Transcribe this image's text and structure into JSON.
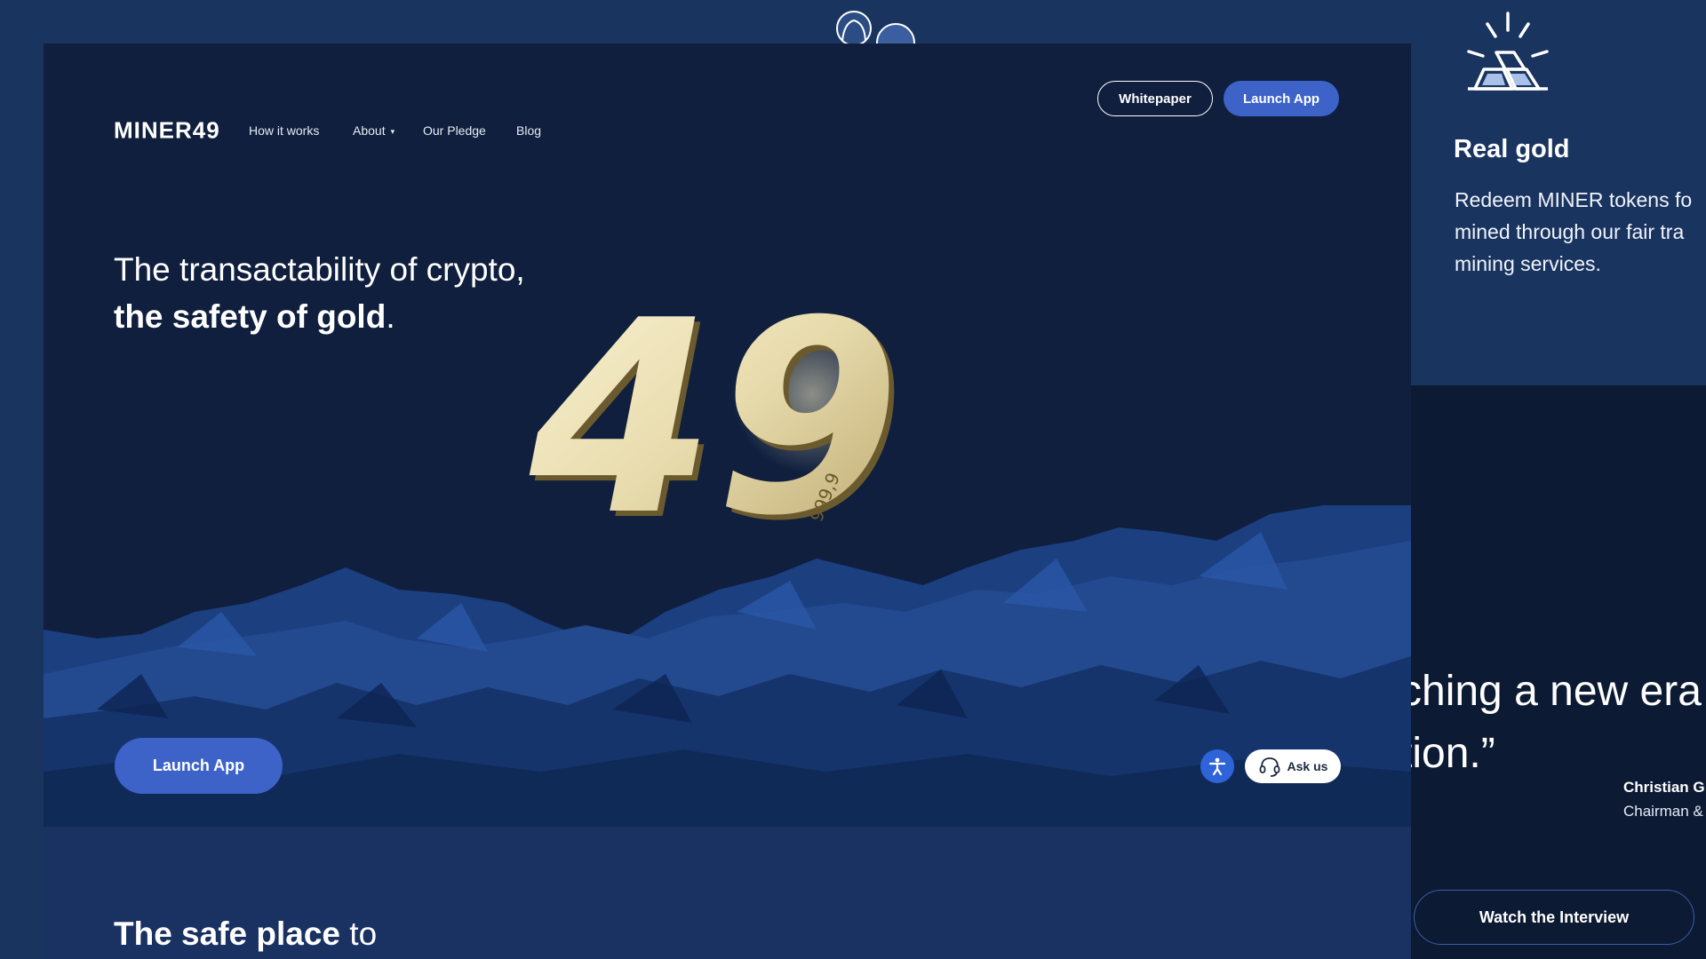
{
  "nav": {
    "logo": "MINER49",
    "links": [
      "How it works",
      "About",
      "Our Pledge",
      "Blog"
    ],
    "about_caret": "▾",
    "whitepaper_label": "Whitepaper",
    "launch_label": "Launch App"
  },
  "hero": {
    "headline_line1": "The transactability of crypto,",
    "headline_line2_strong": "the safety of gold",
    "headline_line2_end": ".",
    "emblem_number": "49",
    "emblem_engraving": "999,9",
    "launch_label": "Launch App"
  },
  "widgets": {
    "accessibility_icon": "accessibility-icon",
    "ask_icon": "headset-icon",
    "ask_label": "Ask us"
  },
  "section2": {
    "title_strong": "The safe place",
    "title_rest": "to"
  },
  "feature": {
    "icon": "gold-bars-icon",
    "title": "Real gold",
    "desc_lines": [
      "Redeem MINER tokens fo",
      "mined through our fair tra",
      "mining services."
    ]
  },
  "quote": {
    "line1": "ching a new era",
    "line2": "tion.”",
    "name": "Christian G",
    "role": "Chairman &",
    "watch_label": "Watch the Interview"
  },
  "colors": {
    "page_bg": "#19345f",
    "hero_bg": "#0f1f3d",
    "accent": "#3d63c9",
    "gold": "#e8dcae"
  }
}
